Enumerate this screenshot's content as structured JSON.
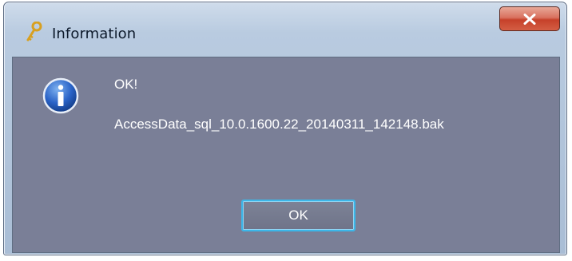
{
  "window": {
    "title": "Information",
    "title_icon": "key-icon",
    "close_icon": "close-icon"
  },
  "dialog": {
    "icon": "info-icon",
    "message_line1": "OK!",
    "message_line2": "AccessData_sql_10.0.1600.22_20140311_142148.bak",
    "ok_label": "OK"
  },
  "colors": {
    "client_background": "#7a7f97",
    "close_button": "#c6412a",
    "focus_border": "#3cb6e8"
  }
}
